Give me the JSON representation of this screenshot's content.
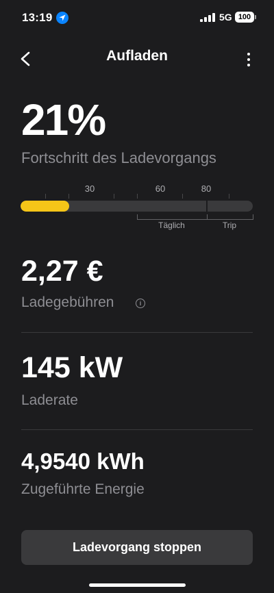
{
  "status_bar": {
    "time": "13:19",
    "network": "5G",
    "battery": "100"
  },
  "header": {
    "title": "Aufladen",
    "back_icon": "chevron-left-icon",
    "menu_icon": "more-vertical-icon"
  },
  "progress": {
    "percent_text": "21%",
    "label": "Fortschritt des Ladevorgangs",
    "level": 0.21,
    "scale_labels": [
      "30",
      "60",
      "80"
    ],
    "daily_label": "Täglich",
    "trip_label": "Trip"
  },
  "cost": {
    "value": "2,27 €",
    "label": "Ladegebühren",
    "info_icon": "info-icon"
  },
  "rate": {
    "value": "145 kW",
    "label": "Laderate"
  },
  "energy": {
    "value": "4,9540 kWh",
    "label": "Zugeführte Energie"
  },
  "actions": {
    "stop_label": "Ladevorgang stoppen"
  },
  "colors": {
    "background": "#1c1c1e",
    "accent": "#f5c518",
    "secondary_text": "#8e8e93",
    "button": "#3a3a3c"
  }
}
